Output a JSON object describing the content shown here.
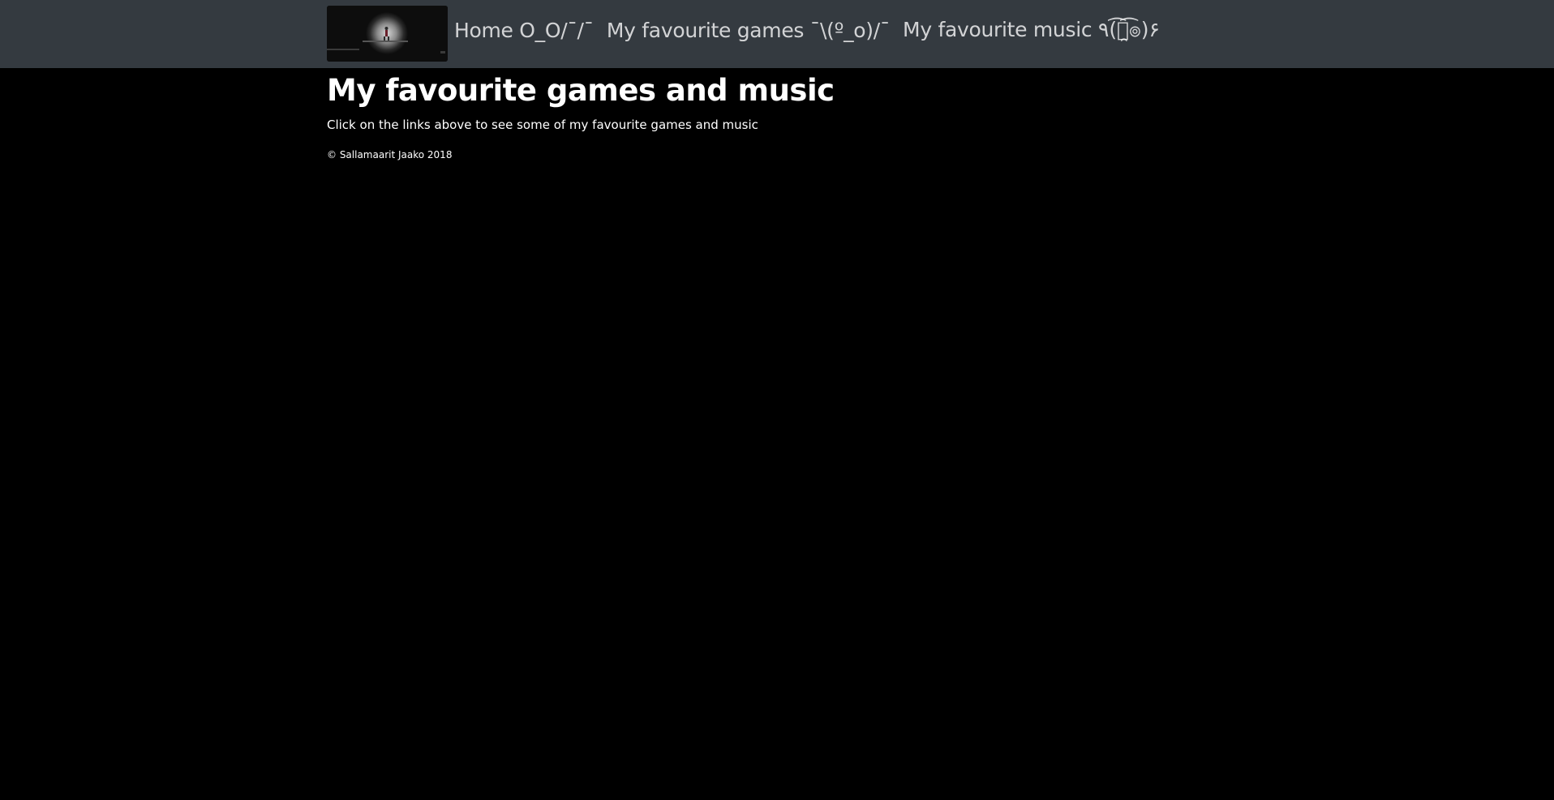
{
  "navbar": {
    "brand_alt": "logo image",
    "links": [
      {
        "label": "Home O_O/¯/¯"
      },
      {
        "label": "My favourite games ¯\\(º_o)/¯"
      },
      {
        "label": "My favourite music ٩(͡๏̯͡๏)۶"
      }
    ]
  },
  "main": {
    "title": "My favourite games and music",
    "intro": "Click on the links above to see some of my favourite games and music"
  },
  "footer": {
    "copyright": "© Sallamaarit Jaako 2018"
  },
  "colors": {
    "navbar_bg": "#343a40",
    "page_bg": "#000000",
    "text": "#ffffff",
    "nav_link": "#c7c8c9"
  },
  "icons": {
    "brand": "game-scene-logo-icon"
  }
}
